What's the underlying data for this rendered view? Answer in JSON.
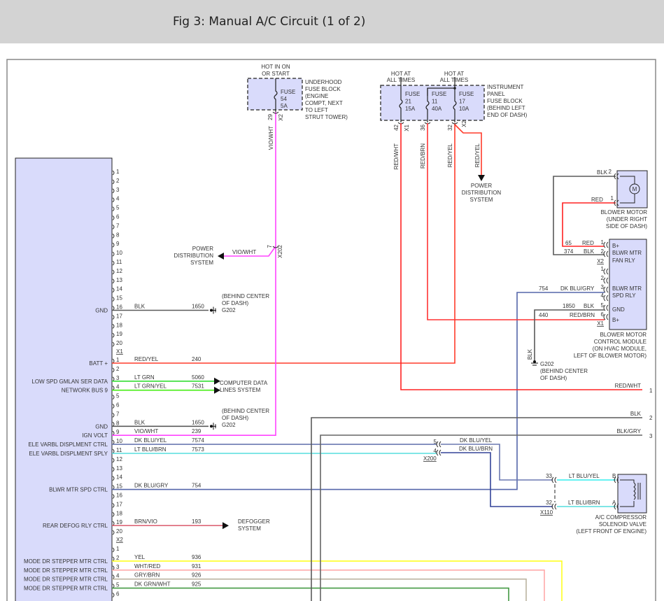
{
  "title": "Fig 3: Manual A/C Circuit (1 of 2)",
  "wire_colors": {
    "BLK": "#5a5a5a",
    "RED/YEL": "#ff3b2b",
    "LT GRN": "#33dd33",
    "LT GRN/YEL": "#44ee11",
    "VIO/WHT": "#ff44ff",
    "DK BLU/YEL": "#6a78b0",
    "LT BLU/BRN": "#55dddd",
    "DK BLU/GRY": "#5566aa",
    "BRN/VIO": "#dd6677",
    "YEL": "#ffff22",
    "WHT/RED": "#ffaaaa",
    "GRY/BRN": "#bbb3a0",
    "DK GRN/WHT": "#449944",
    "RED/WHT": "#ff2222",
    "RED/BRN": "#ff3333",
    "RED": "#ff2222",
    "BLK/GRY": "#666666",
    "DK BLU/BRN": "#334499",
    "LT BLU/YEL": "#33eeee",
    "component_fill": "#d9dbfb",
    "header_bg": "#d3d3d3"
  },
  "module": {
    "connectors": [
      {
        "name": "X1",
        "pins": [
          "1",
          "2",
          "3",
          "4",
          "5",
          "6",
          "7",
          "8",
          "9",
          "10",
          "11",
          "12",
          "13",
          "14",
          "15",
          "16",
          "17",
          "18",
          "19",
          "20"
        ]
      },
      {
        "name": "X2",
        "pins": [
          "1",
          "2",
          "3",
          "4",
          "5",
          "6",
          "7",
          "8",
          "9",
          "10",
          "11",
          "12",
          "13",
          "14",
          "15",
          "16",
          "17",
          "18",
          "19",
          "20"
        ]
      },
      {
        "pins": [
          "1",
          "2",
          "3",
          "4",
          "5",
          "6"
        ]
      }
    ],
    "functions": [
      "GND",
      "BATT +",
      "LOW SPD GMLAN SER DATA",
      "NETWORK BUS 9",
      "GND",
      "IGN VOLT",
      "ELE VARBL DISPLMENT CTRL",
      "ELE VARBL DISPLMENT SPLY",
      "BLWR MTR SPD CTRL",
      "REAR DEFOG RLY CTRL",
      "MODE DR STEPPER MTR CTRL",
      "MODE DR STEPPER MTR CTRL",
      "MODE DR STEPPER MTR CTRL",
      "MODE DR STEPPER MTR CTRL"
    ],
    "wires": [
      {
        "color": "BLK",
        "circuit": "1650"
      },
      {
        "color": "RED/YEL",
        "circuit": "240"
      },
      {
        "color": "LT GRN",
        "circuit": "5060"
      },
      {
        "color": "LT GRN/YEL",
        "circuit": "7531"
      },
      {
        "color": "BLK",
        "circuit": "1650"
      },
      {
        "color": "VIO/WHT",
        "circuit": "239"
      },
      {
        "color": "DK BLU/YEL",
        "circuit": "7574"
      },
      {
        "color": "LT BLU/BRN",
        "circuit": "7573"
      },
      {
        "color": "DK BLU/GRY",
        "circuit": "754"
      },
      {
        "color": "BRN/VIO",
        "circuit": "193"
      },
      {
        "color": "YEL",
        "circuit": "936"
      },
      {
        "color": "WHT/RED",
        "circuit": "931"
      },
      {
        "color": "GRY/BRN",
        "circuit": "926"
      },
      {
        "color": "DK GRN/WHT",
        "circuit": "925"
      }
    ]
  },
  "ground_g202": [
    [
      "(BEHIND CENTER",
      "OF DASH)",
      "G202"
    ],
    [
      "(BEHIND CENTER",
      "OF DASH)",
      "G202"
    ],
    [
      "G202",
      "(BEHIND CENTER",
      "OF DASH)"
    ]
  ],
  "computer_data": [
    "COMPUTER DATA",
    "LINES SYSTEM"
  ],
  "defogger": [
    "DEFOGGER",
    "SYSTEM"
  ],
  "underhood_fuse_block": {
    "hot": [
      "HOT IN ON",
      "OR START"
    ],
    "fuse": [
      "FUSE",
      "54",
      "5A"
    ],
    "location": [
      "UNDERHOOD",
      "FUSE BLOCK",
      "(ENGINE",
      "COMPT, NEXT",
      "TO LEFT",
      "STRUT TOWER)"
    ],
    "pin": "29",
    "connector": "X2",
    "wire": "VIO/WHT"
  },
  "splice": {
    "pin": "7",
    "connector": "X202",
    "wire": "VIO/WHT",
    "destination": [
      "POWER",
      "DISTRIBUTION",
      "SYSTEM"
    ]
  },
  "ip_fuse_block": {
    "hot": [
      [
        "HOT AT",
        "ALL TIMES"
      ],
      [
        "HOT AT",
        "ALL TIMES"
      ]
    ],
    "fuses": [
      [
        "FUSE",
        "21",
        "15A"
      ],
      [
        "FUSE",
        "11",
        "40A"
      ],
      [
        "FUSE",
        "17",
        "10A"
      ]
    ],
    "location": [
      "INSTRUMENT",
      "PANEL",
      "FUSE BLOCK",
      "(BEHIND LEFT",
      "END OF DASH)"
    ],
    "pins": [
      "42",
      "36",
      "32"
    ],
    "connectors": [
      "X1",
      "X2"
    ],
    "wires": [
      "RED/WHT",
      "RED/BRN",
      "RED/YEL",
      "RED/YEL"
    ],
    "destination": [
      "POWER",
      "DISTRIBUTION",
      "SYSTEM"
    ]
  },
  "blower_motor": {
    "pins": [
      "2",
      "1"
    ],
    "wires": [
      "BLK",
      "RED"
    ],
    "motor_symbol": "M",
    "name": [
      "BLOWER MOTOR",
      "(UNDER RIGHT",
      "SIDE OF DASH)"
    ]
  },
  "blower_control_module": {
    "pins": [
      "1",
      "2",
      "X2",
      "1",
      "2",
      "3",
      "4",
      "5",
      "6",
      "X1"
    ],
    "labels": [
      "B+",
      "BLWR MTR",
      "FAN RLY",
      "BLWR MTR",
      "SPD RLY",
      "GND",
      "B+"
    ],
    "wires": [
      {
        "circuit": "65",
        "color": "RED"
      },
      {
        "circuit": "374",
        "color": "BLK"
      },
      {
        "circuit": "754",
        "color": "DK BLU/GRY"
      },
      {
        "circuit": "1850",
        "color": "BLK"
      },
      {
        "circuit": "440",
        "color": "RED/BRN"
      }
    ],
    "ground_wire": "BLK",
    "name": [
      "BLOWER MOTOR",
      "CONTROL MODULE",
      "(ON HVAC MODULE,",
      "LEFT OF BLOWER MOTOR)"
    ]
  },
  "right_wires": [
    {
      "color": "RED/WHT",
      "pin": "1"
    },
    {
      "color": "BLK",
      "pin": "2"
    },
    {
      "color": "BLK/GRY",
      "pin": "3"
    }
  ],
  "x200": {
    "connector": "X200",
    "pins": [
      "5",
      "4"
    ],
    "wires": [
      "DK BLU/YEL",
      "DK BLU/BRN"
    ]
  },
  "x110": {
    "connector": "X110",
    "pins": [
      "33",
      "32"
    ],
    "wires": [
      "LT BLU/YEL",
      "LT BLU/BRN"
    ]
  },
  "solenoid": {
    "pins": [
      "B",
      "A"
    ],
    "name": [
      "A/C COMPRESSOR",
      "SOLENOID VALVE",
      "(LEFT FRONT OF ENGINE)"
    ]
  }
}
